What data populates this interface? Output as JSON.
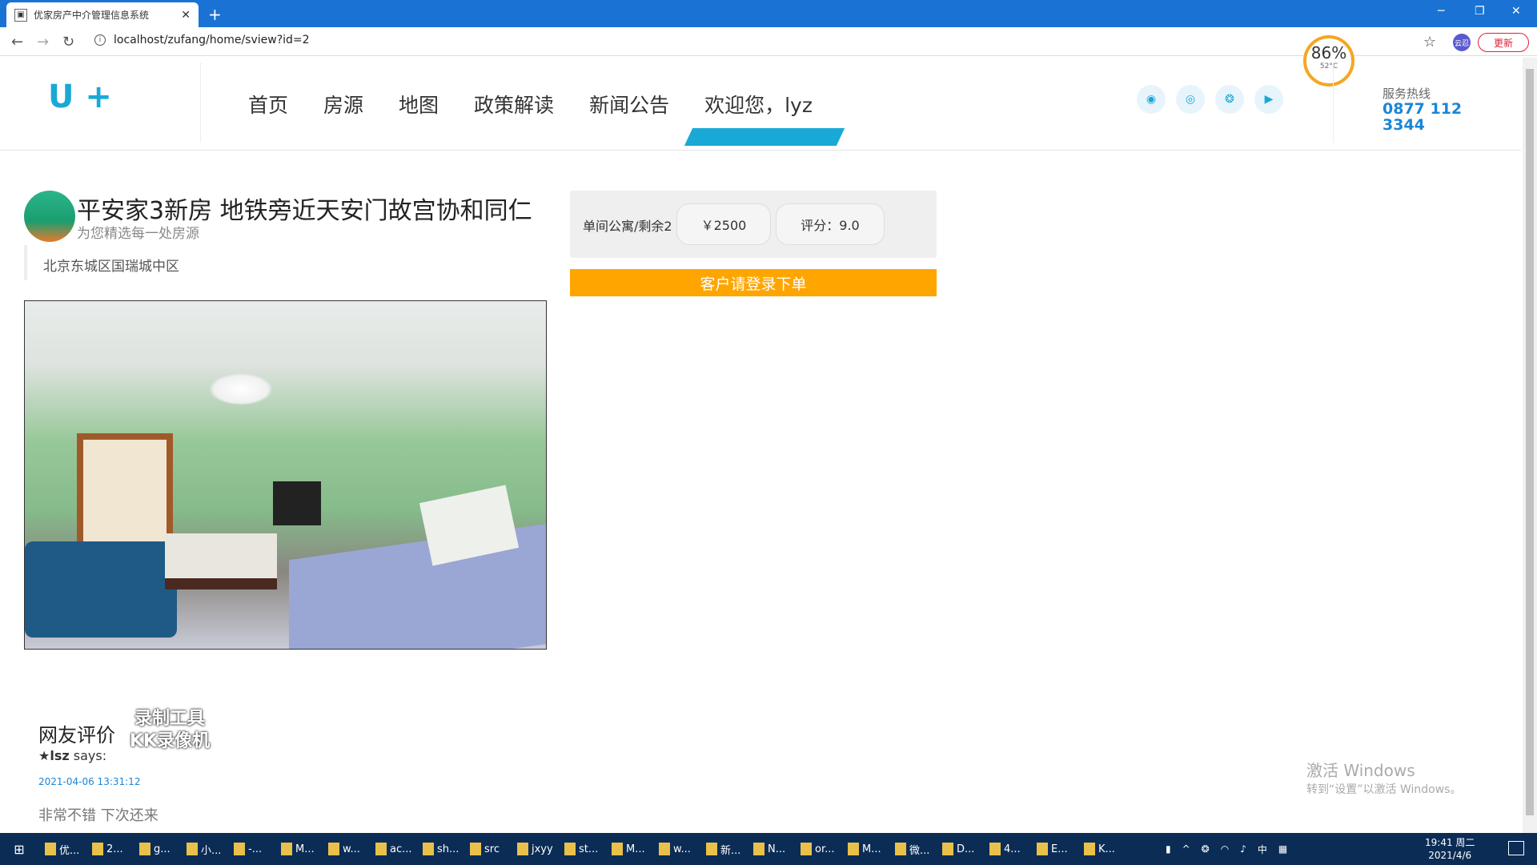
{
  "browser": {
    "tab_title": "优家房产中介管理信息系统",
    "url": "localhost/zufang/home/sview?id=2",
    "update_label": "更新",
    "ext_label": "云忍",
    "gauge_value": "86%",
    "gauge_temp": "52°C"
  },
  "header": {
    "logo": "U +",
    "nav": [
      "首页",
      "房源",
      "地图",
      "政策解读",
      "新闻公告",
      "欢迎您，lyz"
    ],
    "social_icons": [
      "qq-icon",
      "weibo-icon",
      "wechat-icon",
      "video-icon"
    ],
    "hotline_label": "服务热线",
    "hotline_number": "0877 112 3344"
  },
  "listing": {
    "title": "平安家3新房 地铁旁近天安门故宫协和同仁",
    "subtitle": "为您精选每一处房源",
    "address": "北京东城区国瑞城中区",
    "room_type": "单间公寓/剩余2",
    "price": "￥2500",
    "rating": "评分：9.0",
    "order_button": "客户请登录下单"
  },
  "reviews": {
    "heading": "网友评价",
    "watermark_line1": "录制工具",
    "watermark_line2": "KK录像机",
    "items": [
      {
        "user": "lsz",
        "says": "says:",
        "date": "2021-04-06 13:31:12",
        "text": "非常不错 下次还来"
      }
    ]
  },
  "os": {
    "activate_line1": "激活 Windows",
    "activate_line2": "转到“设置”以激活 Windows。",
    "taskbar_items": [
      "优...",
      "2...",
      "g...",
      "小...",
      "-...",
      "M...",
      "w...",
      "ac...",
      "sh...",
      "src",
      "jxyy",
      "st...",
      "M...",
      "w...",
      "新...",
      "N...",
      "or...",
      "M...",
      "微...",
      "D...",
      "4...",
      "E...",
      "K..."
    ],
    "time": "19:41 周二",
    "date": "2021/4/6",
    "ime": "中"
  }
}
